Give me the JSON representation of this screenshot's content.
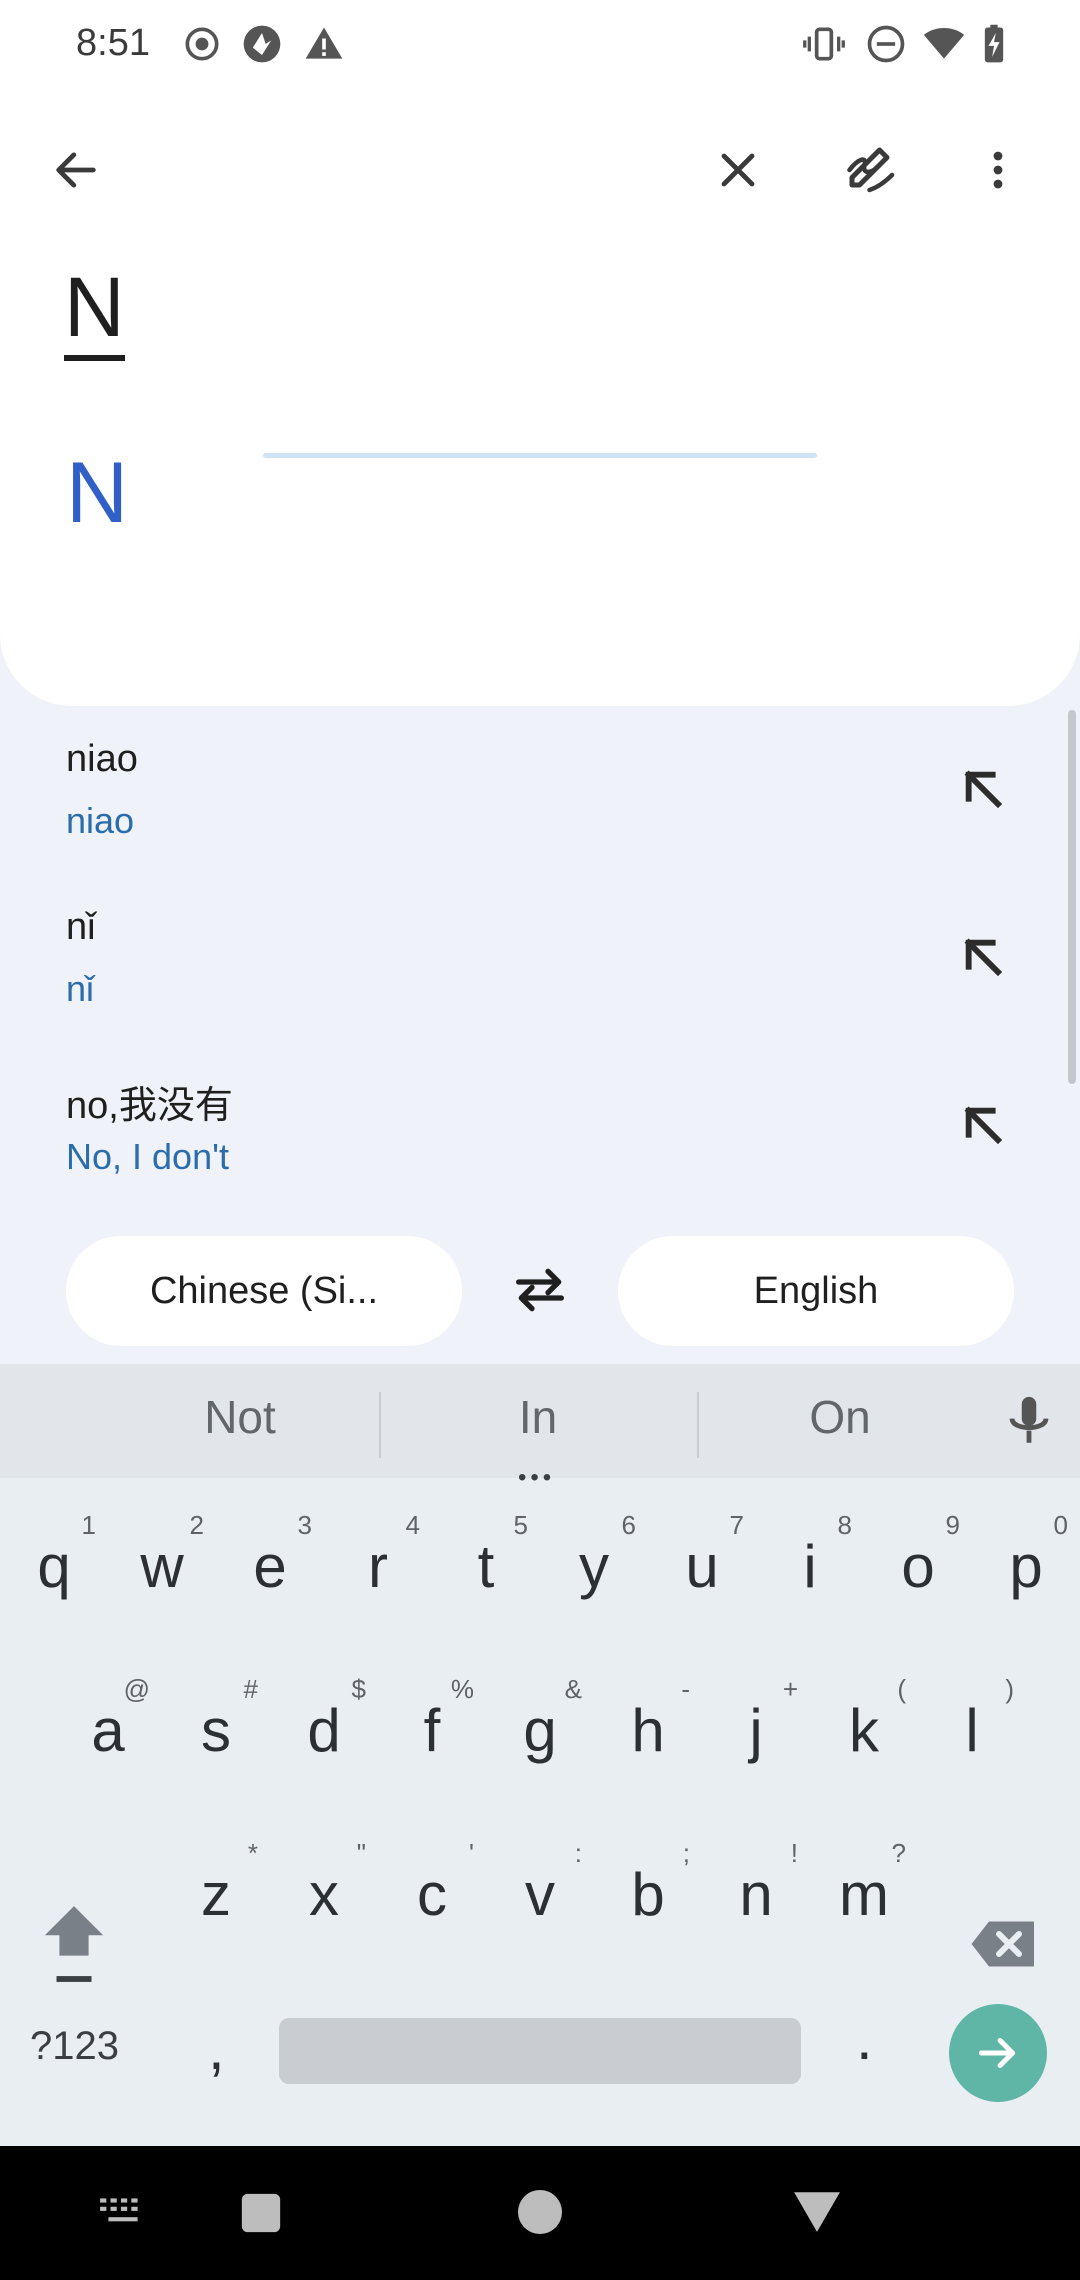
{
  "status_bar": {
    "time": "8:51"
  },
  "toolbar": {
    "back_icon": "arrow-back-icon",
    "clear_icon": "close-icon",
    "handwriting_icon": "handwriting-icon",
    "more_icon": "more-vert-icon"
  },
  "input": {
    "source_text": "N",
    "translation_text": "N"
  },
  "suggestions": [
    {
      "main": "niao",
      "sub": "niao"
    },
    {
      "main": "nǐ",
      "sub": "nǐ"
    },
    {
      "main": "no,我没有",
      "sub": "No, I don't"
    }
  ],
  "languages": {
    "source": "Chinese (Si...",
    "target": "English"
  },
  "keyboard": {
    "suggestions": [
      "Not",
      "In",
      "On"
    ],
    "row1": [
      {
        "k": "q",
        "h": "1"
      },
      {
        "k": "w",
        "h": "2"
      },
      {
        "k": "e",
        "h": "3"
      },
      {
        "k": "r",
        "h": "4"
      },
      {
        "k": "t",
        "h": "5"
      },
      {
        "k": "y",
        "h": "6"
      },
      {
        "k": "u",
        "h": "7"
      },
      {
        "k": "i",
        "h": "8"
      },
      {
        "k": "o",
        "h": "9"
      },
      {
        "k": "p",
        "h": "0"
      }
    ],
    "row2": [
      {
        "k": "a",
        "h": "@"
      },
      {
        "k": "s",
        "h": "#"
      },
      {
        "k": "d",
        "h": "$"
      },
      {
        "k": "f",
        "h": "%"
      },
      {
        "k": "g",
        "h": "&"
      },
      {
        "k": "h",
        "h": "-"
      },
      {
        "k": "j",
        "h": "+"
      },
      {
        "k": "k",
        "h": "("
      },
      {
        "k": "l",
        "h": ")"
      }
    ],
    "row3": [
      {
        "k": "z",
        "h": "*"
      },
      {
        "k": "x",
        "h": "\""
      },
      {
        "k": "c",
        "h": "'"
      },
      {
        "k": "v",
        "h": ":"
      },
      {
        "k": "b",
        "h": ";"
      },
      {
        "k": "n",
        "h": "!"
      },
      {
        "k": "m",
        "h": "?"
      }
    ],
    "symbols_label": "?123",
    "comma": ",",
    "period": "."
  },
  "colors": {
    "accent": "#2f5fc7",
    "enter": "#5fb6a6",
    "suggestion_sub": "#2b6cab"
  }
}
